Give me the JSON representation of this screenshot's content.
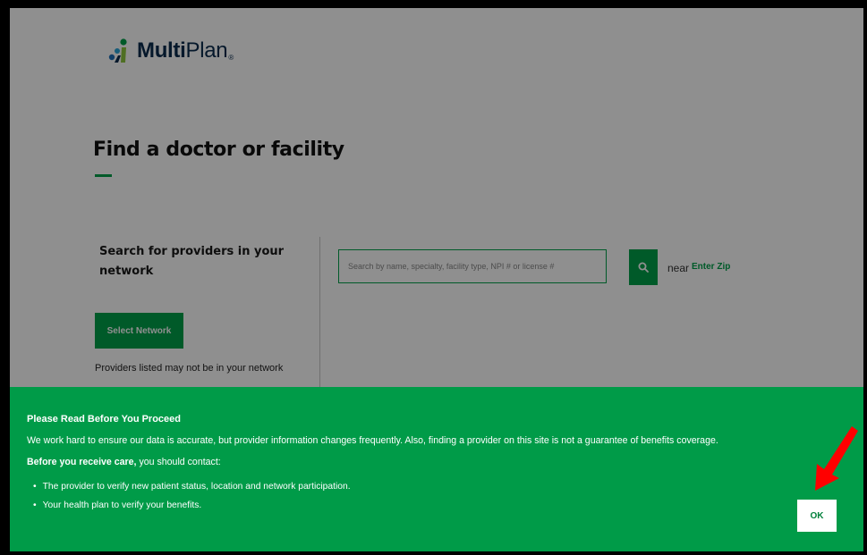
{
  "brand": {
    "name_bold": "Multi",
    "name_light": "Plan",
    "trademark": "®",
    "logo_icon": "multiplan-logo-icon"
  },
  "page": {
    "title": "Find a doctor or facility"
  },
  "network": {
    "heading": "Search for providers in your network",
    "select_button": "Select Network",
    "note": "Providers listed may not be in your network"
  },
  "search": {
    "placeholder": "Search by name, specialty, facility type, NPI # or license #",
    "button_icon": "search-icon",
    "near_label": "near",
    "zip_link": "Enter Zip"
  },
  "banner": {
    "title": "Please Read Before You Proceed",
    "text": "We work hard to ensure our data is accurate, but provider information changes frequently. Also, finding a provider on this site is not a guarantee of benefits coverage.",
    "contact_bold": "Before you receive care,",
    "contact_rest": " you should contact:",
    "items": [
      "The provider to verify new patient status, location and network participation.",
      "Your health plan to verify your benefits."
    ],
    "ok_label": "OK"
  },
  "colors": {
    "brand_green": "#00a04a",
    "banner_green": "#009b48",
    "navy": "#0a2b4e",
    "annotation_red": "#ff0000"
  },
  "annotation": {
    "icon": "red-arrow-icon"
  }
}
